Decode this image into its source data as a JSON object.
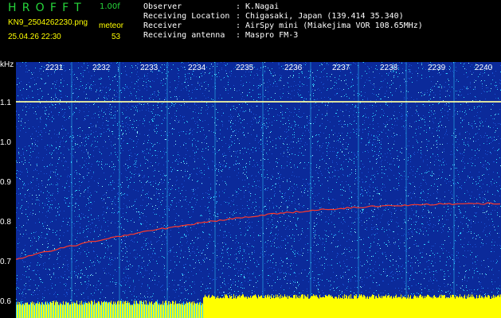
{
  "header": {
    "app_name": "HROFFT",
    "version": "1.00f",
    "filename": "KN9_2504262230.png",
    "datetime": "25.04.26 22:30",
    "meteor_label": "meteor",
    "meteor_count": "53",
    "observer_label": "Observer",
    "observer_value": ": K.Nagai",
    "location_label": "Receiving Location",
    "location_value": ": Chigasaki, Japan (139.414 35.340)",
    "receiver_label": "Receiver",
    "receiver_value": ": AirSpy mini (Miakejima VOR 108.65MHz)",
    "antenna_label": "Receiving antenna",
    "antenna_value": ": Maspro FM-3"
  },
  "axis": {
    "unit": "kHz",
    "y_ticks": [
      "1.1",
      "1.0",
      "0.9",
      "0.8",
      "0.7",
      "0.6"
    ],
    "time_ticks": [
      "2231",
      "2232",
      "2233",
      "2234",
      "2235",
      "2236",
      "2237",
      "2238",
      "2239",
      "2240"
    ]
  },
  "colors": {
    "background": "#0b2a9a",
    "noise_cyan": "#2fd6ff",
    "noise_yellow": "#ffff00",
    "header_green": "#26d63a",
    "trace_red": "#ff3a2a"
  }
}
